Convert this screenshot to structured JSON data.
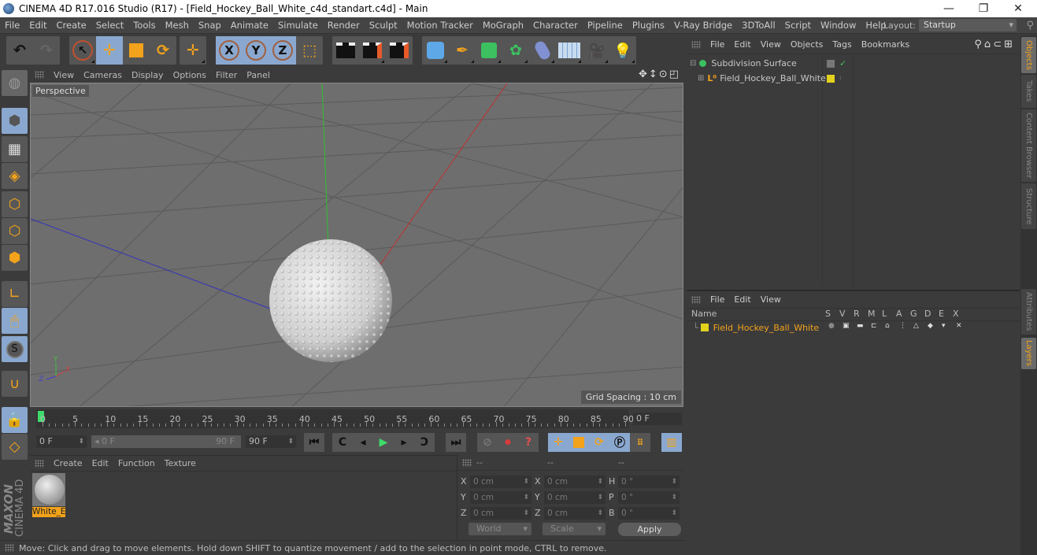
{
  "titlebar": {
    "title": "CINEMA 4D R17.016 Studio (R17) - [Field_Hockey_Ball_White_c4d_standart.c4d] - Main",
    "minimize": "—",
    "restore": "❐",
    "close": "✕"
  },
  "menubar": {
    "items": [
      "File",
      "Edit",
      "Create",
      "Select",
      "Tools",
      "Mesh",
      "Snap",
      "Animate",
      "Simulate",
      "Render",
      "Sculpt",
      "Motion Tracker",
      "MoGraph",
      "Character",
      "Pipeline",
      "Plugins",
      "V-Ray Bridge",
      "3DToAll",
      "Script",
      "Window",
      "Help"
    ],
    "layout_label": "Layout:",
    "layout_value": "Startup"
  },
  "toolbar": {
    "icons": [
      "undo-icon",
      "redo-icon",
      "live-selection-icon",
      "move-icon",
      "scale-icon",
      "rotate-icon",
      "transform-icon",
      "x-axis-icon",
      "y-axis-icon",
      "z-axis-icon",
      "coordinate-system-icon",
      "render-view-icon",
      "render-to-picture-viewer-icon",
      "render-settings-icon",
      "cube-icon",
      "pen-spline-icon",
      "subdivision-surface-icon",
      "cloner-icon",
      "deformer-icon",
      "floor-icon",
      "camera-icon",
      "light-icon"
    ],
    "x": "X",
    "y": "Y",
    "z": "Z"
  },
  "viewport": {
    "menu": [
      "View",
      "Cameras",
      "Display",
      "Options",
      "Filter",
      "Panel"
    ],
    "camera_label": "Perspective",
    "grid_spacing": "Grid Spacing : 10 cm",
    "axis_x": "X",
    "axis_y": "Y",
    "axis_z": "Z"
  },
  "timeline": {
    "ticks": [
      "0",
      "5",
      "10",
      "15",
      "20",
      "25",
      "30",
      "35",
      "40",
      "45",
      "50",
      "55",
      "60",
      "65",
      "70",
      "75",
      "80",
      "85",
      "90"
    ],
    "current_frame": "0 F",
    "start_field": "0 F",
    "range_start": "0 F",
    "range_end": "90 F",
    "end_field": "90 F"
  },
  "material": {
    "menu": [
      "Create",
      "Edit",
      "Function",
      "Texture"
    ],
    "name": "White_E"
  },
  "coordinates": {
    "headers": [
      "--",
      "--",
      "--"
    ],
    "rows": [
      {
        "l1": "X",
        "v1": "0 cm",
        "l2": "X",
        "v2": "0 cm",
        "l3": "H",
        "v3": "0 °"
      },
      {
        "l1": "Y",
        "v1": "0 cm",
        "l2": "Y",
        "v2": "0 cm",
        "l3": "P",
        "v3": "0 °"
      },
      {
        "l1": "Z",
        "v1": "0 cm",
        "l2": "Z",
        "v2": "0 cm",
        "l3": "B",
        "v3": "0 °"
      }
    ],
    "mode": "World",
    "type": "Scale",
    "apply": "Apply"
  },
  "status": {
    "text": "Move: Click and drag to move elements. Hold down SHIFT to quantize movement / add to the selection in point mode, CTRL to remove."
  },
  "branding": {
    "maxon": "MAXON",
    "cinema": "CINEMA 4D"
  },
  "objects": {
    "menu": [
      "File",
      "Edit",
      "View",
      "Objects",
      "Tags",
      "Bookmarks"
    ],
    "items": [
      {
        "name": "Subdivision Surface"
      },
      {
        "name": "Field_Hockey_Ball_White"
      }
    ]
  },
  "layers": {
    "menu": [
      "File",
      "Edit",
      "View"
    ],
    "name_header": "Name",
    "columns": [
      "S",
      "V",
      "R",
      "M",
      "L",
      "A",
      "G",
      "D",
      "E",
      "X"
    ],
    "items": [
      {
        "name": "Field_Hockey_Ball_White",
        "color": "#e3d21c"
      }
    ]
  },
  "sidetabs": {
    "top": [
      "Objects",
      "Takes",
      "Content Browser",
      "Structure"
    ],
    "bottom": [
      "Attributes",
      "Layers"
    ]
  },
  "colors": {
    "accent": "#f2a21b",
    "selected": "#8aa8cf",
    "x_axis": "#d04040",
    "y_axis": "#40c040",
    "z_axis": "#4040d0"
  }
}
